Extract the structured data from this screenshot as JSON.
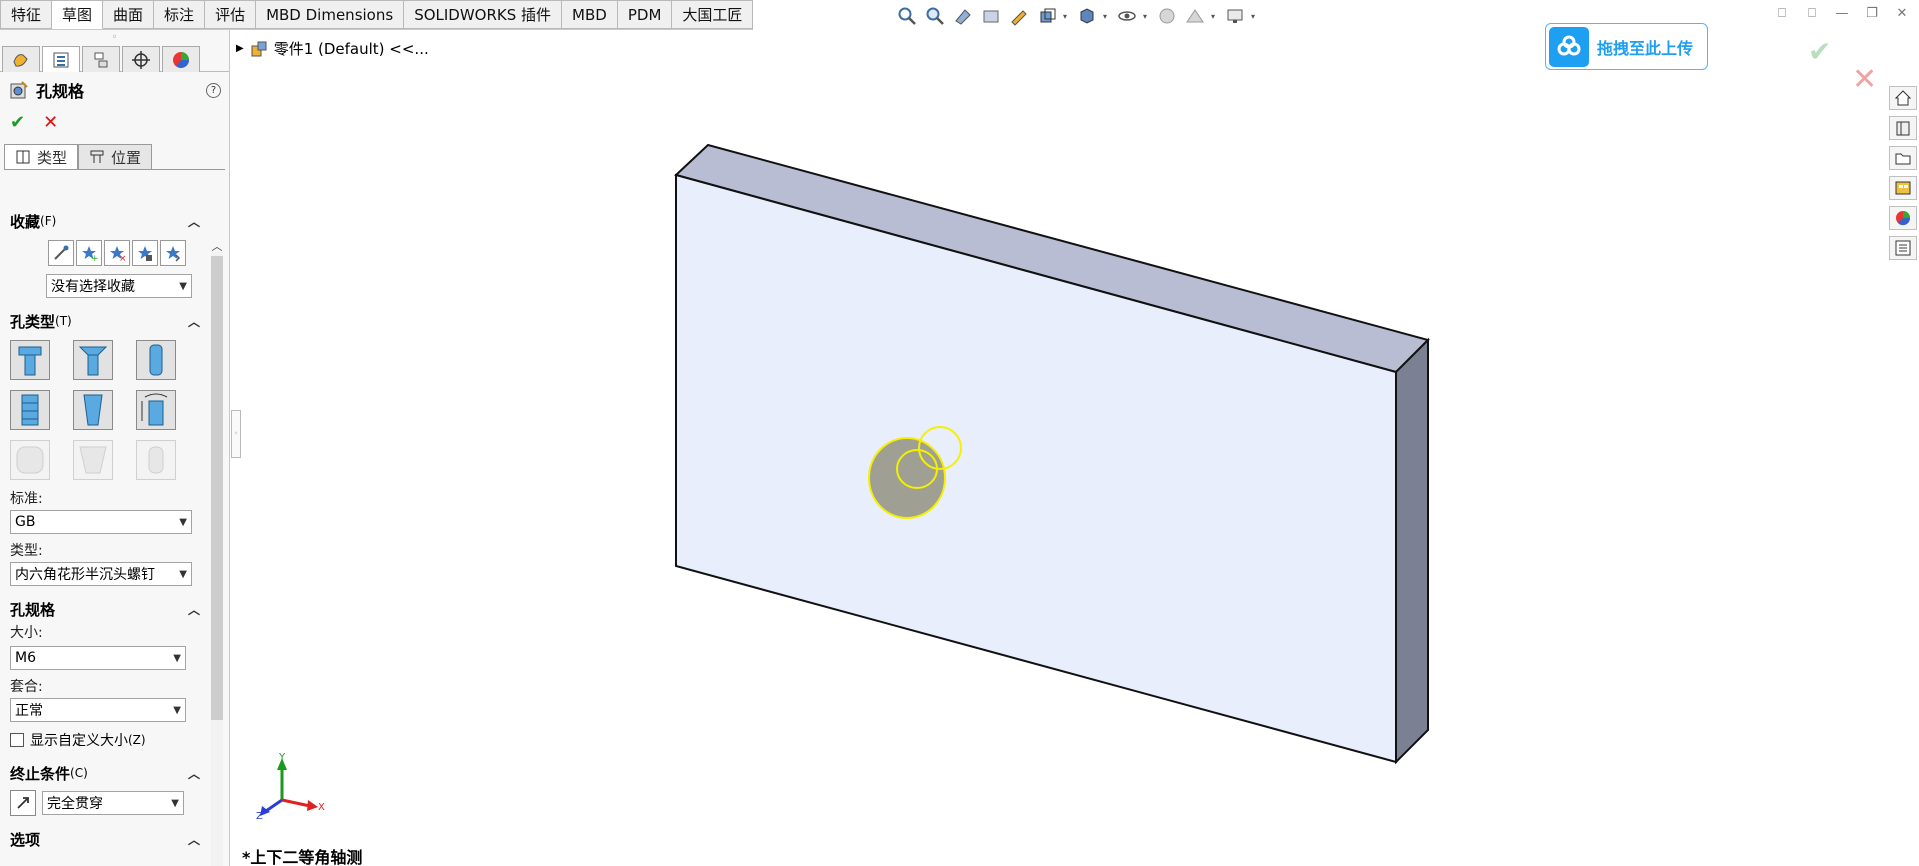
{
  "tabs": [
    {
      "label": "特征",
      "active": false
    },
    {
      "label": "草图",
      "active": true
    },
    {
      "label": "曲面",
      "active": false
    },
    {
      "label": "标注",
      "active": false
    },
    {
      "label": "评估",
      "active": false
    },
    {
      "label": "MBD Dimensions",
      "active": false
    },
    {
      "label": "SOLIDWORKS 插件",
      "active": false
    },
    {
      "label": "MBD",
      "active": false
    },
    {
      "label": "PDM",
      "active": false
    },
    {
      "label": "大国工匠",
      "active": false
    }
  ],
  "tree": {
    "root_label": "零件1 (Default) <<..."
  },
  "property_manager": {
    "title": "孔规格",
    "help": "?",
    "ok": "✔",
    "cancel": "✕",
    "sub_tabs": [
      {
        "label": "类型",
        "active": true
      },
      {
        "label": "位置",
        "active": false
      }
    ],
    "favorites": {
      "title": "收藏",
      "hotkey": "(F)",
      "dropdown": "没有选择收藏"
    },
    "hole_type": {
      "title": "孔类型",
      "hotkey": "(T)",
      "standard_label": "标准:",
      "standard_value": "GB",
      "type_label": "类型:",
      "type_value": "内六角花形半沉头螺钉"
    },
    "hole_spec": {
      "title": "孔规格",
      "size_label": "大小:",
      "size_value": "M6",
      "fit_label": "套合:",
      "fit_value": "正常",
      "custom_size": "显示自定义大小",
      "custom_size_hotkey": "(Z)"
    },
    "end_condition": {
      "title": "终止条件",
      "hotkey": "(C)",
      "value": "完全贯穿"
    },
    "options": {
      "title": "选项"
    }
  },
  "upload": {
    "label": "拖拽至此上传"
  },
  "view": {
    "name": "*上下二等角轴测"
  },
  "triad": {
    "x": "X",
    "y": "Y",
    "z": "Z"
  },
  "colors": {
    "accent": "#1f9ff2",
    "face": "#e8eefb",
    "top": "#b9bdd4",
    "side": "#7b8092",
    "highlight": "#f4f000"
  }
}
